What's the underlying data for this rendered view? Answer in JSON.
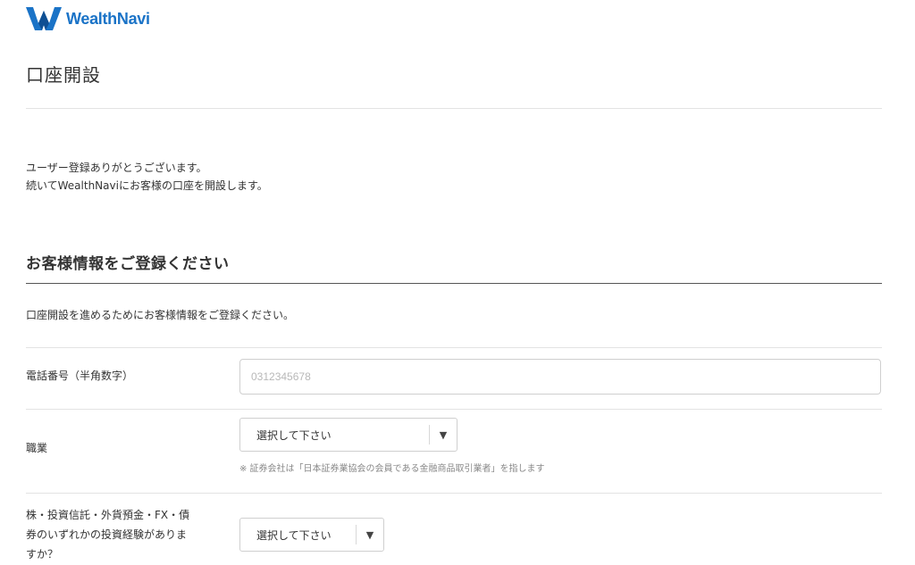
{
  "brand": {
    "logo_text": "WealthNavi",
    "accent_color": "#1a73c7"
  },
  "page": {
    "title": "口座開設"
  },
  "intro": {
    "line1": "ユーザー登録ありがとうございます。",
    "line2": "続いてWealthNaviにお客様の口座を開設します。"
  },
  "section": {
    "heading": "お客様情報をご登録ください",
    "description": "口座開設を進めるためにお客様情報をご登録ください。"
  },
  "fields": {
    "phone": {
      "label": "電話番号（半角数字）",
      "placeholder": "0312345678",
      "value": ""
    },
    "occupation": {
      "label": "職業",
      "selected": "選択して下さい",
      "arrow_icon": "caret-down-icon",
      "note": "※ 証券会社は「日本証券業協会の会員である金融商品取引業者」を指します"
    },
    "investment_experience": {
      "label_line1": "株・投資信託・外貨預金・FX・債",
      "label_line2": "券のいずれかの投資経験がありま",
      "label_line3": "すか？",
      "selected": "選択して下さい",
      "arrow_icon": "caret-down-icon"
    }
  }
}
